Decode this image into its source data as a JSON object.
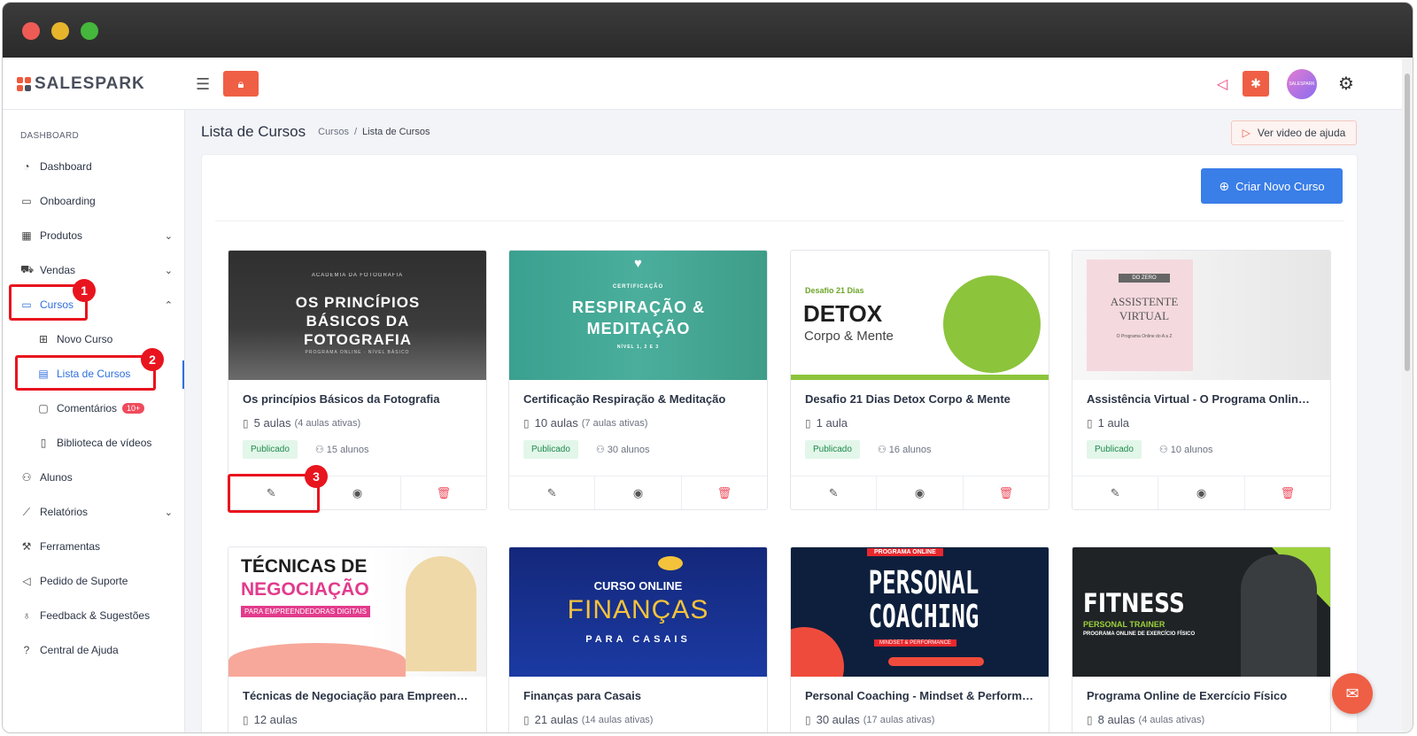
{
  "app": {
    "logo_text": "SALESPARK",
    "avatar_text": "SALESPARK"
  },
  "colors": {
    "accent": "#3a7ee8",
    "brand": "#ef5f45",
    "danger": "#ef4b5c",
    "success_bg": "#e3f6ea",
    "highlight": "#e8141e"
  },
  "sidebar": {
    "heading": "DASHBOARD",
    "items": [
      {
        "label": "Dashboard",
        "icon": "gauge-icon"
      },
      {
        "label": "Onboarding",
        "icon": "video-icon"
      },
      {
        "label": "Produtos",
        "icon": "grid-icon",
        "chevron": "down"
      },
      {
        "label": "Vendas",
        "icon": "cart-icon",
        "chevron": "down"
      },
      {
        "label": "Cursos",
        "icon": "monitor-icon",
        "chevron": "up"
      },
      {
        "label": "Novo Curso",
        "icon": "file-plus-icon"
      },
      {
        "label": "Lista de Cursos",
        "icon": "table-icon"
      },
      {
        "label": "Comentários",
        "icon": "comment-icon",
        "badge": "10+"
      },
      {
        "label": "Biblioteca de vídeos",
        "icon": "book-icon"
      },
      {
        "label": "Alunos",
        "icon": "users-icon"
      },
      {
        "label": "Relatórios",
        "icon": "chart-icon",
        "chevron": "down"
      },
      {
        "label": "Ferramentas",
        "icon": "wrench-icon"
      },
      {
        "label": "Pedido de Suporte",
        "icon": "megaphone-icon"
      },
      {
        "label": "Feedback & Sugestões",
        "icon": "bulb-icon"
      },
      {
        "label": "Central de Ajuda",
        "icon": "help-icon"
      }
    ]
  },
  "header": {
    "title": "Lista de Cursos",
    "breadcrumb": [
      "Cursos",
      "Lista de Cursos"
    ],
    "help_button": "Ver video de ajuda",
    "create_button": "Criar Novo Curso"
  },
  "courses": [
    {
      "title": "Os princípios Básicos da Fotografia",
      "lessons": "5 aulas",
      "active": "(4 aulas ativas)",
      "status": "Publicado",
      "students": "15 alunos",
      "cover": {
        "small_top": "ACADEMIA DA FOTOGRAFIA",
        "main": "OS PRINCÍPIOS BÁSICOS DA FOTOGRAFIA",
        "small_bottom": "PROGRAMA ONLINE · NÍVEL BÁSICO"
      }
    },
    {
      "title": "Certificação Respiração & Meditação",
      "lessons": "10 aulas",
      "active": "(7 aulas ativas)",
      "status": "Publicado",
      "students": "30 alunos",
      "cover": {
        "small_top": "CERTIFICAÇÃO",
        "main": "RESPIRAÇÃO & MEDITAÇÃO",
        "small_bottom": "NÍVEL 1, 2 E 3"
      }
    },
    {
      "title": "Desafio 21 Dias Detox Corpo & Mente",
      "lessons": "1 aula",
      "active": "",
      "status": "Publicado",
      "students": "16 alunos",
      "cover": {
        "small_top": "Desafio 21 Dias",
        "main": "DETOX",
        "small_bottom": "Corpo & Mente"
      }
    },
    {
      "title": "Assistência Virtual - O Programa Online d...",
      "lessons": "1 aula",
      "active": "",
      "status": "Publicado",
      "students": "10 alunos",
      "cover": {
        "small_top": "DO ZERO",
        "main": "ASSISTENTE VIRTUAL",
        "small_bottom": "O Programa Online do A a Z"
      }
    },
    {
      "title": "Técnicas de Negociação para Empreended...",
      "lessons": "12 aulas",
      "active": "",
      "status": "",
      "students": "",
      "cover": {
        "small_top": "TÉCNICAS DE",
        "main": "NEGOCIAÇÃO",
        "small_bottom": "PARA EMPREENDEDORAS DIGITAIS"
      }
    },
    {
      "title": "Finanças para Casais",
      "lessons": "21 aulas",
      "active": "(14 aulas ativas)",
      "status": "",
      "students": "",
      "cover": {
        "small_top": "CURSO ONLINE",
        "main": "FINANÇAS",
        "small_bottom": "PARA CASAIS"
      }
    },
    {
      "title": "Personal Coaching - Mindset & Performan...",
      "lessons": "30 aulas",
      "active": "(17 aulas ativas)",
      "status": "",
      "students": "",
      "cover": {
        "small_top": "PROGRAMA ONLINE",
        "main": "PERSONAL COACHING",
        "small_bottom": "MINDSET & PERFORMANCE"
      }
    },
    {
      "title": "Programa Online de Exercício Físico",
      "lessons": "8 aulas",
      "active": "(4 aulas ativas)",
      "status": "",
      "students": "",
      "cover": {
        "small_top": "FITNESS",
        "main": "PERSONAL TRAINER",
        "small_bottom": "PROGRAMA ONLINE DE EXERCÍCIO FÍSICO"
      }
    }
  ],
  "annotations": [
    "1",
    "2",
    "3"
  ]
}
